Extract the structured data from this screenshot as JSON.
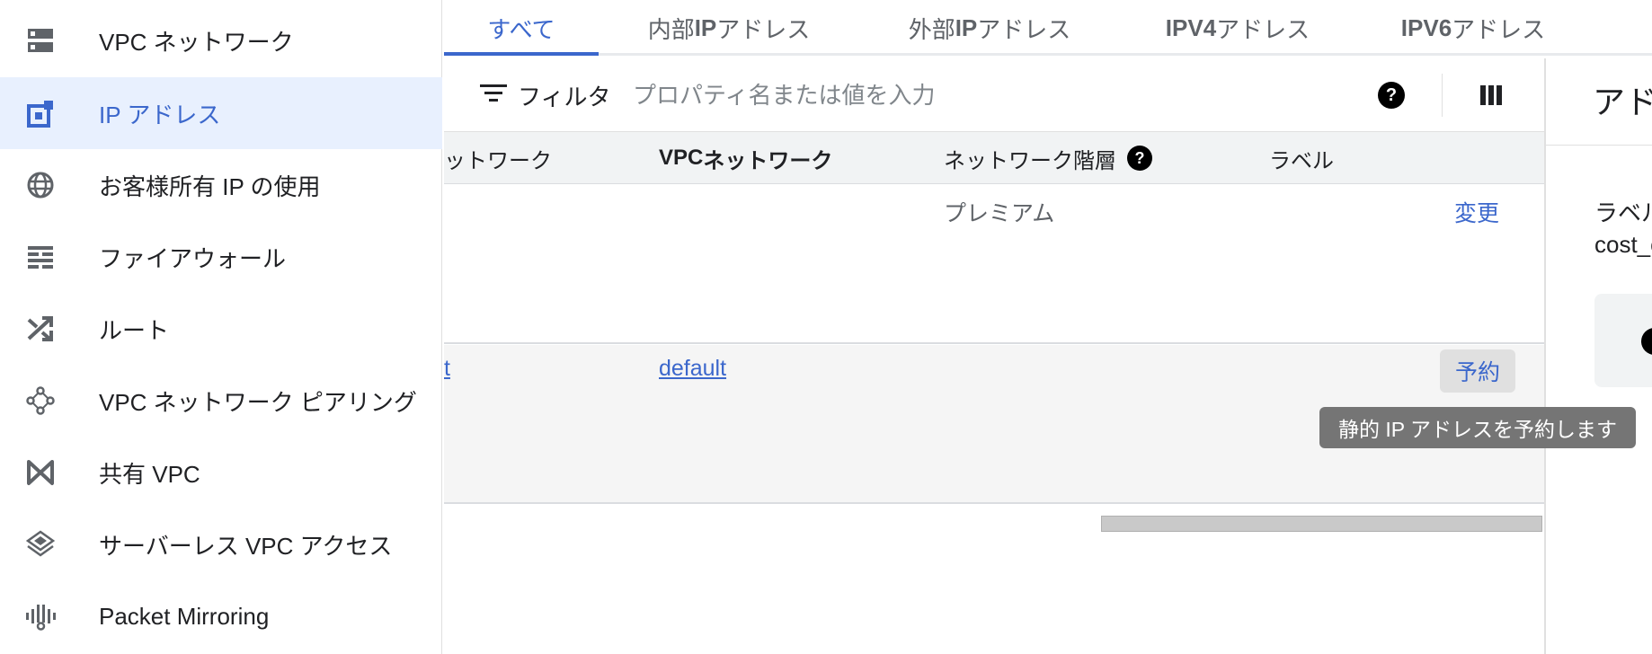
{
  "sidebar": {
    "items": [
      {
        "label": "VPC ネットワーク",
        "icon": "vpc-network-icon",
        "active": false
      },
      {
        "label": "IP アドレス",
        "icon": "ip-address-icon",
        "active": true
      },
      {
        "label": "お客様所有 IP の使用",
        "icon": "globe-icon",
        "active": false
      },
      {
        "label": "ファイアウォール",
        "icon": "firewall-icon",
        "active": false
      },
      {
        "label": "ルート",
        "icon": "routes-icon",
        "active": false
      },
      {
        "label": "VPC ネットワーク ピアリング",
        "icon": "peering-icon",
        "active": false
      },
      {
        "label": "共有 VPC",
        "icon": "shared-vpc-icon",
        "active": false
      },
      {
        "label": "サーバーレス VPC アクセス",
        "icon": "serverless-vpc-icon",
        "active": false
      },
      {
        "label": "Packet Mirroring",
        "icon": "packet-mirroring-icon",
        "active": false
      }
    ]
  },
  "tabs": [
    {
      "label": "すべて",
      "active": true
    },
    {
      "label_prefix": "内部 ",
      "label_bold": "IP",
      "label_suffix": " アドレス"
    },
    {
      "label_prefix": "外部 ",
      "label_bold": "IP",
      "label_suffix": " アドレス"
    },
    {
      "label_bold": "IPV4",
      "label_suffix": " アドレス"
    },
    {
      "label_bold": "IPV6",
      "label_suffix": " アドレス"
    }
  ],
  "filter": {
    "label": "フィルタ",
    "placeholder": "プロパティ名または値を入力",
    "help": "?"
  },
  "table": {
    "headers": {
      "network_partial": "ットワーク",
      "vpc_bold": "VPC",
      "vpc_rest": " ネットワーク",
      "tier": "ネットワーク階層",
      "tier_help": "?",
      "labels": "ラベル"
    },
    "rows": [
      {
        "network_partial": "",
        "vpc_network": "",
        "tier": "プレミアム",
        "action": "変更"
      },
      {
        "network_partial": "t",
        "vpc_network": "default",
        "tier": "",
        "action": "予約"
      }
    ]
  },
  "tooltip": "静的 IP アドレスを予約します",
  "right_panel": {
    "title_partial": "アド",
    "label_partial": "ラベル",
    "value_partial": "cost_c"
  },
  "colors": {
    "accent": "#3b67cc",
    "active_bg": "#e8f0fe",
    "tooltip_bg": "#757575"
  }
}
